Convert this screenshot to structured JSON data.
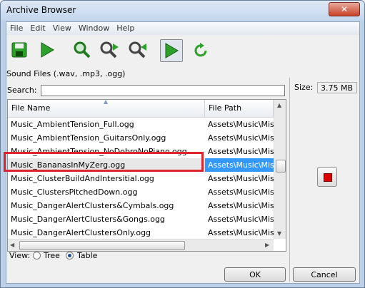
{
  "window": {
    "title": "Archive Browser",
    "close_glyph": "✕"
  },
  "menu": [
    "File",
    "Edit",
    "View",
    "Window",
    "Help"
  ],
  "toolbar": {
    "icons": [
      "save-icon",
      "play-icon",
      "search-icon",
      "search-next-icon",
      "search-previous-icon",
      "autoplay-icon",
      "refresh-icon"
    ],
    "colors": {
      "green": "#2ea12a",
      "accent": "#3399ff",
      "highlight_border": "#e0242d",
      "stop": "#dd0000"
    }
  },
  "filter_label": "Sound Files (.wav, .mp3, .ogg)",
  "search": {
    "label": "Search:",
    "value": ""
  },
  "table": {
    "headers": {
      "name": "File Name",
      "path": "File Path"
    },
    "rows": [
      {
        "name": "Music_AmbientTension_Full.ogg",
        "path": "Assets\\Music\\Missi"
      },
      {
        "name": "Music_AmbientTension_GuitarsOnly.ogg",
        "path": "Assets\\Music\\Missi"
      },
      {
        "name": "Music_AmbientTension_NoDobroNoPiano.ogg",
        "path": "Assets\\Music\\Missi"
      },
      {
        "name": "Music_BananasInMyZerg.ogg",
        "path": "Assets\\Music\\Missi"
      },
      {
        "name": "Music_ClusterBuildAndIntersitial.ogg",
        "path": "Assets\\Music\\Missi"
      },
      {
        "name": "Music_ClustersPitchedDown.ogg",
        "path": "Assets\\Music\\Missi"
      },
      {
        "name": "Music_DangerAlertClusters&Cymbals.ogg",
        "path": "Assets\\Music\\Missi"
      },
      {
        "name": "Music_DangerAlertClusters&Gongs.ogg",
        "path": "Assets\\Music\\Missi"
      },
      {
        "name": "Music_DangerAlertClustersOnly.ogg",
        "path": "Assets\\Music\\Missi"
      }
    ],
    "selected_index": 3
  },
  "view": {
    "label": "View:",
    "options": [
      "Tree",
      "Table"
    ],
    "selected": "Table"
  },
  "size": {
    "label": "Size:",
    "value": "3.75 MB"
  },
  "buttons": {
    "ok": "OK",
    "cancel": "Cancel"
  }
}
